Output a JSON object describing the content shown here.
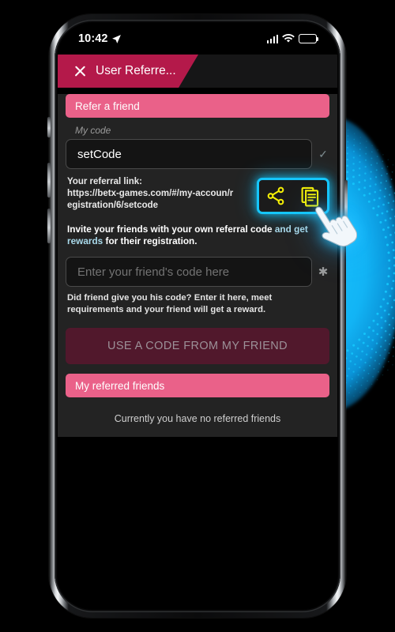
{
  "status_bar": {
    "time": "10:42",
    "location_icon": "location-arrow-icon",
    "signal_icon": "cellular-signal-icon",
    "wifi_icon": "wifi-icon",
    "battery_icon": "battery-full-icon"
  },
  "header": {
    "close_icon": "close-x-icon",
    "title": "User Referre..."
  },
  "sections": {
    "refer_a_friend_label": "Refer a friend",
    "my_referred_friends_label": "My referred friends"
  },
  "my_code": {
    "label": "My code",
    "value": "setCode",
    "valid_icon": "checkmark-icon"
  },
  "referral_link": {
    "caption": "Your referral link:",
    "url": "https://betx-games.com/#/my-accoun/registration/6/setcode",
    "share_icon": "share-nodes-icon",
    "copy_icon": "copy-document-icon",
    "highlight_color": "#15c6fb",
    "icon_color": "#f5f006"
  },
  "invite": {
    "text_plain": "Invite your friends with your own referral code ",
    "text_link": "and get rewards",
    "text_tail": " for their registration."
  },
  "friend_code": {
    "placeholder": "Enter your friend's code here",
    "value": "",
    "required_icon": "asterisk-icon",
    "hint": "Did friend give you his code? Enter it here, meet requirements and your friend will get a reward."
  },
  "cta": {
    "label": "USE A CODE FROM MY FRIEND"
  },
  "referred_friends": {
    "empty_text": "Currently you have no referred friends"
  },
  "cursor": {
    "icon": "pointing-hand-cursor"
  },
  "colors": {
    "brand_crimson": "#b4194a",
    "brand_pink": "#ea6189",
    "cta_maroon": "#51182c",
    "glow_cyan": "#15c6fb",
    "panel_gray": "#232323"
  }
}
